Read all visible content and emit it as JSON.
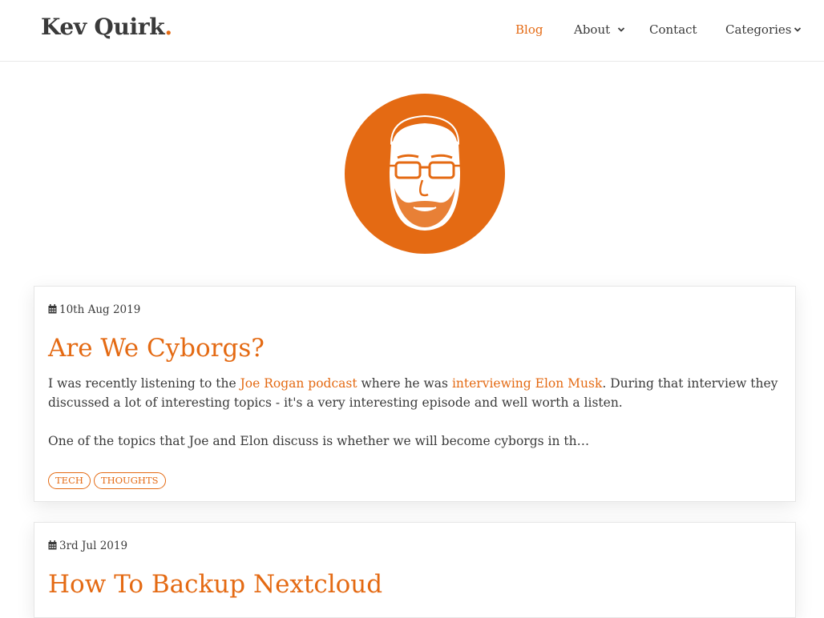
{
  "site": {
    "logo_text": "Kev Quirk",
    "logo_dot": ".",
    "accent_color": "#e46a13"
  },
  "nav": {
    "blog": "Blog",
    "about": "About",
    "contact": "Contact",
    "categories": "Categories"
  },
  "posts": [
    {
      "date": "10th Aug 2019",
      "title": "Are We Cyborgs?",
      "excerpt": {
        "p1_a": "I was recently listening to the ",
        "link1": "Joe Rogan podcast",
        "p1_b": " where he was ",
        "link2": "interviewing Elon Musk",
        "p1_c": ". During that interview they discussed a lot of interesting topics - it's a very interesting episode and well worth a listen.",
        "p2": "One of the topics that Joe and Elon discuss is whether we will become cyborgs in th…"
      },
      "tags": [
        "TECH",
        "THOUGHTS"
      ]
    },
    {
      "date": "3rd Jul 2019",
      "title": "How To Backup Nextcloud"
    }
  ]
}
